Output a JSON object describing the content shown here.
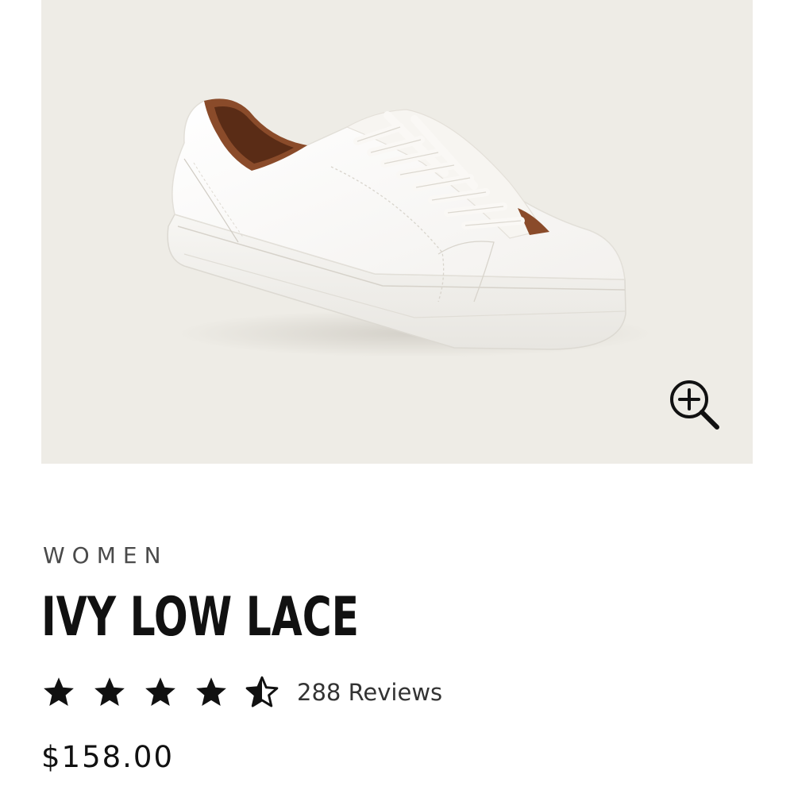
{
  "product": {
    "image": {
      "icon": "sneaker-image",
      "alt": "White leather low-top lace-up sneaker",
      "background_color": "#eeece6"
    },
    "zoom_button": {
      "icon": "zoom-in-icon"
    },
    "category": "WOMEN",
    "title": "IVY LOW LACE",
    "rating": {
      "stars_filled": 4,
      "stars_half": 1,
      "stars_total": 5,
      "value": 4.5
    },
    "reviews_label": "288 Reviews",
    "price": "$158.00"
  }
}
